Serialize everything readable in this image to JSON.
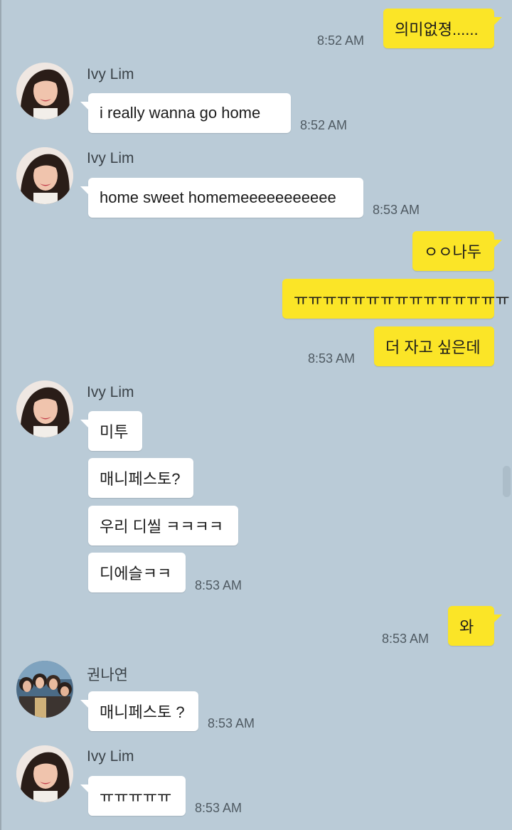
{
  "accent_colors": {
    "my_bubble": "#fbe527",
    "their_bubble": "#ffffff",
    "background": "#bacbd7"
  },
  "avatar_icons": {
    "ivy_lim": "woman-portrait-avatar",
    "kwon_nayeon": "group-photo-avatar"
  },
  "messages": {
    "m1": {
      "text": "의미없졍......",
      "time": "8:52 AM"
    },
    "g1": {
      "sender": "Ivy Lim",
      "text": "i really wanna go home",
      "time": "8:52 AM"
    },
    "g2": {
      "sender": "Ivy Lim",
      "text": "home sweet homemeeeeeeeeeee",
      "time": "8:53 AM"
    },
    "m2": {
      "text": "ㅇㅇ나두"
    },
    "m3": {
      "text": "ㅠㅠㅠㅠㅠㅠㅠㅠㅠㅠㅠㅠㅠㅠㅠ"
    },
    "m4": {
      "text": "더 자고 싶은데",
      "time": "8:53 AM"
    },
    "g3": {
      "sender": "Ivy Lim",
      "texts": [
        "미투",
        "매니페스토?",
        "우리 디씰 ㅋㅋㅋㅋ",
        "디에슬ㅋㅋ"
      ],
      "time": "8:53 AM"
    },
    "m5": {
      "text": "와",
      "time": "8:53 AM"
    },
    "g4": {
      "sender": "권나연",
      "text": "매니페스토 ?",
      "time": "8:53 AM"
    },
    "g5": {
      "sender": "Ivy Lim",
      "text": "ㅠㅠㅠㅠㅠ",
      "time": "8:53 AM"
    }
  }
}
